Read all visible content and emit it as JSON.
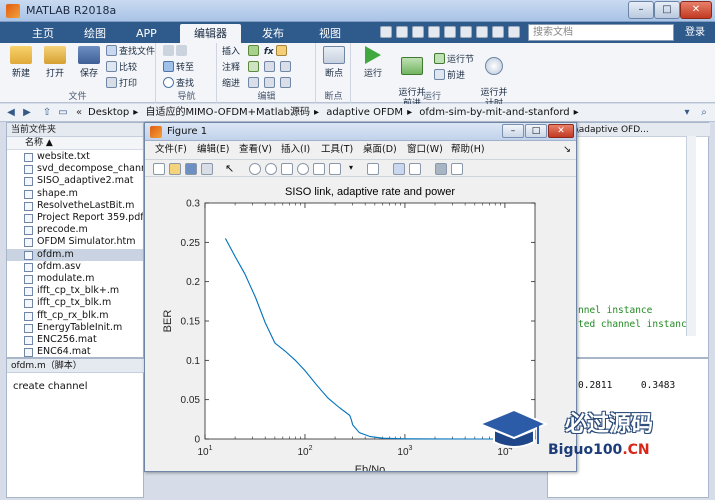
{
  "window": {
    "title": "MATLAB R2018a",
    "min": "–",
    "max": "□",
    "close": "✕"
  },
  "tabs": [
    "主页",
    "绘图",
    "APP",
    "编辑器",
    "发布",
    "视图"
  ],
  "active_tab": "编辑器",
  "search": {
    "placeholder": "搜索文档"
  },
  "login": "登录",
  "ribbon": {
    "file_group": {
      "label": "文件",
      "new": "新建",
      "open": "打开",
      "save": "保存",
      "find_files": "查找文件",
      "compare": "比较",
      "print": "打印"
    },
    "nav_group": {
      "label": "导航",
      "goto": "转至",
      "find": "查找"
    },
    "edit_group": {
      "label": "编辑",
      "insert": "插入",
      "comment": "注释",
      "indent": "缩进",
      "fx": "fx"
    },
    "breakpoint_group": {
      "label": "断点",
      "breakpoints": "断点"
    },
    "run_group": {
      "label": "运行",
      "run": "运行",
      "run_and_advance": "运行并\n前进",
      "run_section": "运行节",
      "advance": "前进",
      "run_and_time": "运行并\n计时"
    }
  },
  "address": {
    "path": [
      "Desktop",
      "自适应的MIMO-OFDM+Matlab源码",
      "adaptive OFDM",
      "ofdm-sim-by-mit-and-stanford"
    ]
  },
  "folder_panel": {
    "header": "当前文件夹",
    "column": "名称 ▲",
    "files": [
      "website.txt",
      "svd_decompose_chann...",
      "SISO_adaptive2.mat",
      "shape.m",
      "ResolvetheLastBit.m",
      "Project Report 359.pdf",
      "precode.m",
      "OFDM Simulator.htm",
      "ofdm.m",
      "ofdm.asv",
      "modulate.m",
      "ifft_cp_tx_blk+.m",
      "ifft_cp_tx_blk.m",
      "fft_cp_rx_blk.m",
      "EnergyTableInit.m",
      "ENC256.mat",
      "ENC64.mat"
    ],
    "selected": "ofdm.m"
  },
  "detail_panel": {
    "header": "ofdm.m（脚本）",
    "text": "create channel"
  },
  "editor": {
    "tab": "b源码\\adaptive OFD...",
    "lines": [
      "nnel instance",
      "ted channel instance"
    ]
  },
  "command": {
    "line": "0.2811     0.3483"
  },
  "figure": {
    "title": "Figure 1",
    "menus": [
      "文件(F)",
      "编辑(E)",
      "查看(V)",
      "插入(I)",
      "工具(T)",
      "桌面(D)",
      "窗口(W)",
      "帮助(H)"
    ]
  },
  "chart_data": {
    "type": "line",
    "title": "SISO link, adaptive rate and power",
    "xlabel": "Eb/No",
    "ylabel": "BER",
    "xscale": "log",
    "xlim": [
      10,
      20000
    ],
    "ylim": [
      0,
      0.3
    ],
    "x_ticks": [
      "10^1",
      "10^2",
      "10^3",
      "10^4"
    ],
    "y_ticks": [
      "0",
      "0.05",
      "0.1",
      "0.15",
      "0.2",
      "0.25",
      "0.3"
    ],
    "grid": false,
    "series": [
      {
        "color": "#0072bd",
        "x": [
          16,
          20,
          25,
          32,
          40,
          50,
          63,
          80,
          100,
          130,
          170,
          220,
          280,
          290,
          300,
          350,
          450,
          600,
          800,
          1000,
          2000,
          5000,
          10000
        ],
        "y": [
          0.255,
          0.232,
          0.21,
          0.18,
          0.148,
          0.122,
          0.112,
          0.1,
          0.087,
          0.069,
          0.052,
          0.04,
          0.03,
          0.025,
          0.018,
          0.008,
          0.003,
          0.001,
          0.0005,
          0.0003,
          0.0001,
          0.0,
          0.0
        ]
      }
    ]
  },
  "watermark": {
    "line1": "必过源码",
    "line2_a": "Biguo100",
    "line2_b": ".CN"
  }
}
